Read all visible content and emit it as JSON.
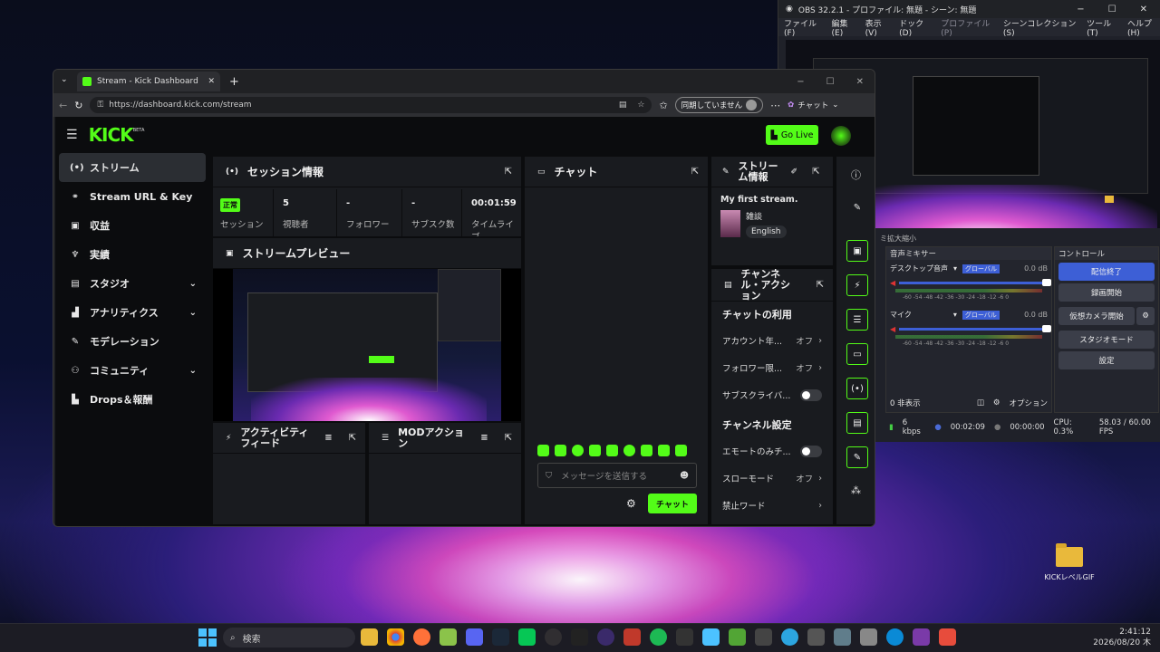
{
  "desktop": {
    "folder_label": "KICKレベルGIF"
  },
  "taskbar": {
    "search_label": "検索",
    "time": "2:41:12",
    "date": "2026/08/20 木"
  },
  "obs": {
    "title": "OBS 32.2.1 - プロファイル: 無題 - シーン: 無題",
    "menu": [
      "ファイル(F)",
      "編集(E)",
      "表示(V)",
      "ドック(D)",
      "プロファイル(P)",
      "シーンコレクション(S)",
      "ツール(T)",
      "ヘルプ(H)"
    ],
    "scene_sources": "ミ拡大縮小",
    "mixer_title": "音声ミキサー",
    "mixer": [
      {
        "name": "デスクトップ音声",
        "tag": "グローバル",
        "db": "0.0 dB"
      },
      {
        "name": "マイク",
        "tag": "グローバル",
        "db": "0.0 dB"
      }
    ],
    "meter_scale": "-60 -54 -48 -42 -36 -30 -24 -18 -12 -6 0",
    "hidden_count": "0 非表示",
    "options": "オプション",
    "controls_title": "コントロール",
    "controls": [
      "配信終了",
      "録画開始",
      "仮想カメラ開始",
      "スタジオモード",
      "設定"
    ],
    "status": {
      "bitrate": "6 kbps",
      "stream_time": "00:02:09",
      "rec_time": "00:00:00",
      "cpu": "CPU: 0.3%",
      "fps": "58.03 / 60.00 FPS"
    }
  },
  "browser": {
    "tab_title": "Stream - Kick Dashboard",
    "url": "https://dashboard.kick.com/stream",
    "sync_label": "同期していません",
    "copilot_label": "チャット"
  },
  "kick": {
    "logo": "KICK",
    "beta": "BETA",
    "go_live": "Go Live",
    "sidebar": [
      {
        "label": "ストリーム",
        "icon": "broadcast-icon",
        "glyph": "(•)"
      },
      {
        "label": "Stream URL & Key",
        "icon": "link-icon",
        "glyph": "⚭"
      },
      {
        "label": "収益",
        "icon": "revenue-icon",
        "glyph": "▣"
      },
      {
        "label": "実績",
        "icon": "trophy-icon",
        "glyph": "♆"
      },
      {
        "label": "スタジオ",
        "icon": "studio-icon",
        "glyph": "▤"
      },
      {
        "label": "アナリティクス",
        "icon": "analytics-icon",
        "glyph": "▟"
      },
      {
        "label": "モデレーション",
        "icon": "wrench-icon",
        "glyph": "✎"
      },
      {
        "label": "コミュニティ",
        "icon": "community-icon",
        "glyph": "⚇"
      },
      {
        "label": "Drops＆報酬",
        "icon": "drops-icon",
        "glyph": "▙"
      }
    ],
    "session": {
      "title": "セッション情報",
      "status_badge": "正常",
      "stats": [
        {
          "value": "",
          "label": "セッション"
        },
        {
          "value": "5",
          "label": "視聴者"
        },
        {
          "value": "-",
          "label": "フォロワー"
        },
        {
          "value": "-",
          "label": "サブスク数"
        },
        {
          "value": "00:01:59",
          "label": "タイムライブ"
        }
      ]
    },
    "preview": {
      "title": "ストリームプレビュー"
    },
    "activity": {
      "title": "アクティビティフィード"
    },
    "mod": {
      "title": "MODアクション"
    },
    "chat": {
      "title": "チャット",
      "placeholder": "メッセージを送信する",
      "send": "チャット"
    },
    "stream_info": {
      "title": "ストリーム情報",
      "stream_title": "My first stream.",
      "category": "雑談",
      "language": "English"
    },
    "channel_actions": {
      "title": "チャンネル・アクション",
      "chat_section": "チャットの利用",
      "chat_rows": [
        {
          "label": "アカウント年...",
          "value": "オフ",
          "type": "chevron"
        },
        {
          "label": "フォロワー限...",
          "value": "オフ",
          "type": "chevron"
        },
        {
          "label": "サブスクライバ...",
          "value": "",
          "type": "toggle"
        }
      ],
      "channel_section": "チャンネル設定",
      "channel_rows": [
        {
          "label": "エモートのみチ...",
          "value": "",
          "type": "toggle"
        },
        {
          "label": "スローモード",
          "value": "オフ",
          "type": "chevron"
        },
        {
          "label": "禁止ワード",
          "value": "",
          "type": "chevron"
        }
      ]
    }
  }
}
